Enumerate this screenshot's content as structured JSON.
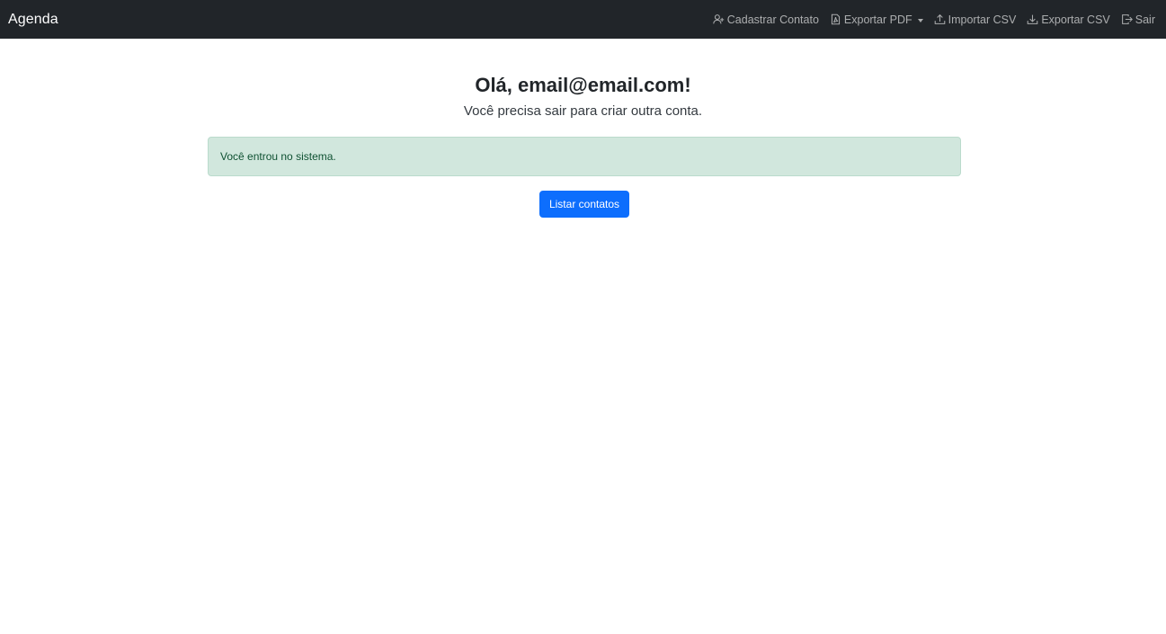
{
  "navbar": {
    "brand": "Agenda",
    "links": [
      {
        "label": "Cadastrar Contato",
        "icon": "person-add-icon"
      },
      {
        "label": "Exportar PDF",
        "icon": "file-pdf-icon",
        "dropdown": true
      },
      {
        "label": "Importar CSV",
        "icon": "upload-icon"
      },
      {
        "label": "Exportar CSV",
        "icon": "download-icon"
      },
      {
        "label": "Sair",
        "icon": "box-arrow-right-icon"
      }
    ]
  },
  "main": {
    "greeting": "Olá, email@email.com!",
    "subtext": "Você precisa sair para criar outra conta.",
    "alert": "Você entrou no sistema.",
    "list_button": "Listar contatos"
  },
  "colors": {
    "navbar_bg": "#212529",
    "alert_bg": "#d1e7dd",
    "alert_text": "#0f5132",
    "primary": "#0d6efd"
  }
}
